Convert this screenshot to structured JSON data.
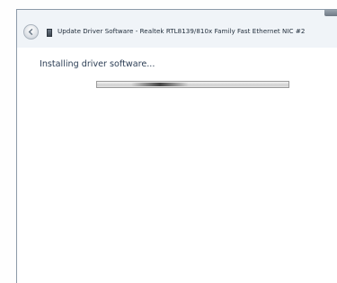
{
  "window": {
    "title": "Update Driver Software - Realtek RTL8139/810x Family Fast Ethernet NIC #2"
  },
  "main": {
    "heading": "Installing driver software...",
    "progress": {
      "mode": "indeterminate",
      "glow_position_fraction": 0.18
    }
  },
  "colors": {
    "title_text": "#1d2a38",
    "heading_text": "#2c3e55",
    "window_frame": "#f0f4f8"
  },
  "icons": [
    "back-arrow-icon",
    "driver-device-icon"
  ]
}
